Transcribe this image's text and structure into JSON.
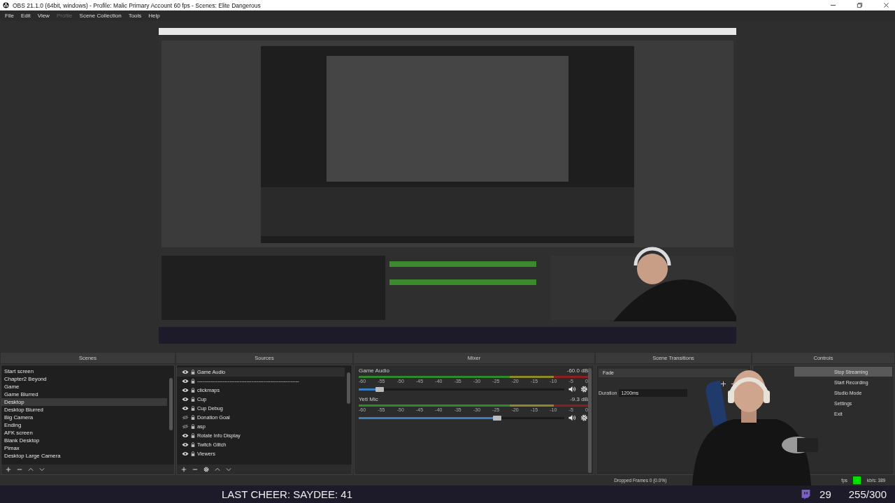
{
  "window": {
    "title": "OBS 21.1.0 (64bit, windows) - Profile: Malic Primary Account 60 fps - Scenes: Elite Dangerous"
  },
  "menu": [
    {
      "label": "File",
      "disabled": false
    },
    {
      "label": "Edit",
      "disabled": false
    },
    {
      "label": "View",
      "disabled": false
    },
    {
      "label": "Profile",
      "disabled": true
    },
    {
      "label": "Scene Collection",
      "disabled": false
    },
    {
      "label": "Tools",
      "disabled": false
    },
    {
      "label": "Help",
      "disabled": false
    }
  ],
  "scenes": {
    "title": "Scenes",
    "items": [
      {
        "name": "Start screen",
        "selected": false
      },
      {
        "name": "Chapter2 Beyond",
        "selected": false
      },
      {
        "name": "Game",
        "selected": false
      },
      {
        "name": "Game Blurred",
        "selected": false
      },
      {
        "name": "Desktop",
        "selected": true
      },
      {
        "name": "Desktop Blurred",
        "selected": false
      },
      {
        "name": "Big Camera",
        "selected": false
      },
      {
        "name": "Ending",
        "selected": false
      },
      {
        "name": "AFK screen",
        "selected": false
      },
      {
        "name": "Blank Desktop",
        "selected": false
      },
      {
        "name": "Pimax",
        "selected": false
      },
      {
        "name": "Desktop Large Camera",
        "selected": false
      }
    ]
  },
  "sources": {
    "title": "Sources",
    "items": [
      {
        "name": "Game Audio",
        "visible": true,
        "selected": true
      },
      {
        "name": "------------------------------------------------------------",
        "visible": true,
        "selected": false
      },
      {
        "name": "clickmaps",
        "visible": true,
        "selected": false
      },
      {
        "name": "Cup",
        "visible": true,
        "selected": false
      },
      {
        "name": "Cup Debug",
        "visible": true,
        "selected": false
      },
      {
        "name": "Donation Goal",
        "visible": false,
        "selected": false
      },
      {
        "name": "asp",
        "visible": false,
        "selected": false
      },
      {
        "name": "Rotate Info Display",
        "visible": true,
        "selected": false
      },
      {
        "name": "Twitch Glitch",
        "visible": true,
        "selected": false
      },
      {
        "name": "Viewers",
        "visible": true,
        "selected": false
      }
    ]
  },
  "mixer": {
    "title": "Mixer",
    "channels": [
      {
        "name": "Game Audio",
        "reading": "-60.0 dB",
        "level": 0.11,
        "ticks": [
          "-60",
          "-55",
          "-50",
          "-45",
          "-40",
          "-35",
          "-30",
          "-25",
          "-20",
          "-15",
          "-10",
          "-5",
          "0"
        ]
      },
      {
        "name": "Yeti Mic",
        "reading": "-9.3 dB",
        "level": 0.68,
        "ticks": [
          "-60",
          "-55",
          "-50",
          "-45",
          "-40",
          "-35",
          "-30",
          "-25",
          "-20",
          "-15",
          "-10",
          "-5",
          "0"
        ]
      }
    ]
  },
  "transitions": {
    "title": "Scene Transitions",
    "selected": "Fade",
    "duration_label": "Duration",
    "duration": "1200ms"
  },
  "controls": {
    "title": "Controls",
    "buttons": [
      {
        "label": "Stop Streaming",
        "active": true
      },
      {
        "label": "Start Recording",
        "active": false
      },
      {
        "label": "Studio Mode",
        "active": false
      },
      {
        "label": "Settings",
        "active": false
      },
      {
        "label": "Exit",
        "active": false
      }
    ]
  },
  "status_bar": {
    "dropped_frames": "Dropped Frames 0 (0.0%)",
    "fps": "fps",
    "bitrate": "kb/s: 389"
  },
  "overlay": {
    "cheer": "LAST CHEER: SAYDEE: 41",
    "viewers": "29",
    "goal": "255/300"
  }
}
